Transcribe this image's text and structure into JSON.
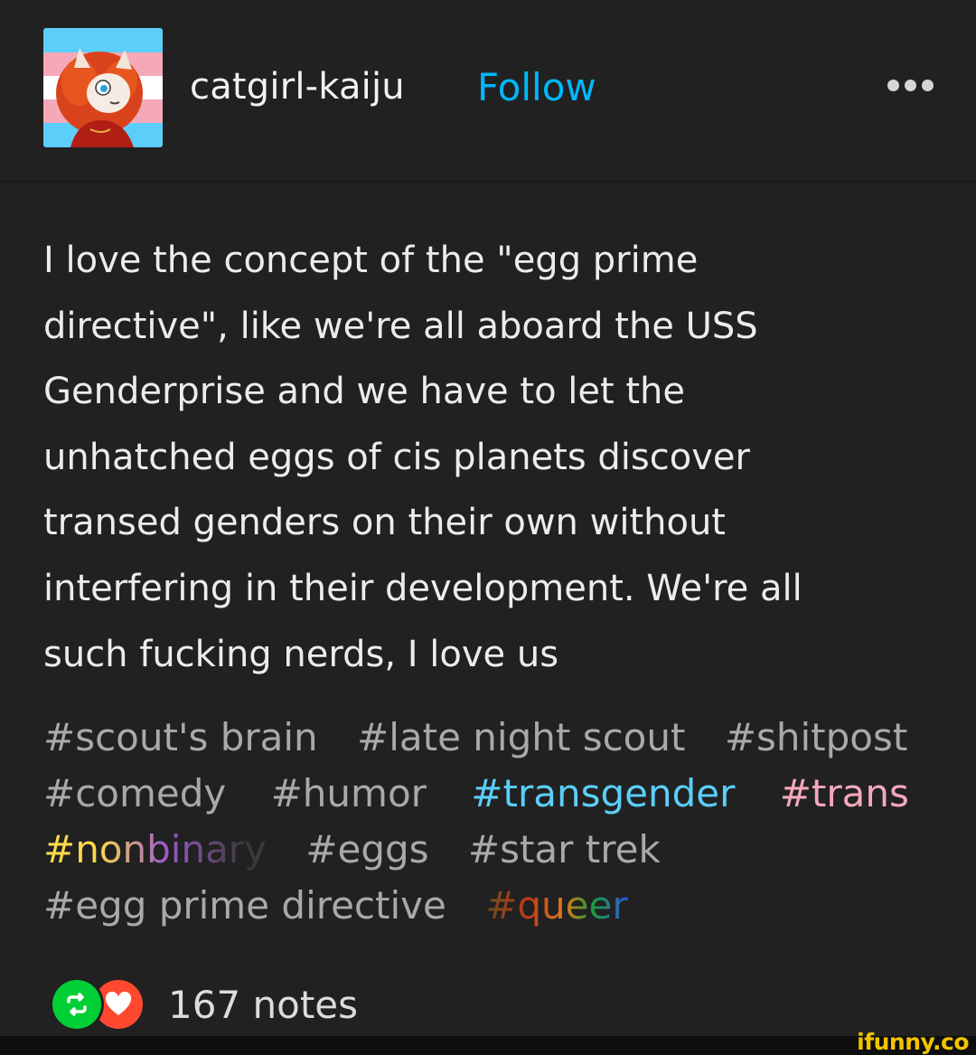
{
  "header": {
    "username": "catgirl-kaiju",
    "follow_label": "Follow",
    "more_icon": "more-horizontal-icon"
  },
  "post": {
    "lines": [
      "I love the concept of the \"egg prime",
      "directive\", like we're all aboard the USS",
      "Genderprise and we have to let the",
      "unhatched eggs of cis planets discover",
      "transed genders on their own without",
      "interfering in their development. We're all",
      "such fucking nerds, I love us"
    ]
  },
  "tags": [
    "#scout's brain",
    "#late night scout",
    "#shitpost",
    "#comedy",
    "#humor",
    "#transgender",
    "#trans",
    "#nonbinary",
    "#eggs",
    "#star trek",
    "#egg prime directive",
    "#queer"
  ],
  "footer": {
    "notes_label": "167 notes",
    "reblog_icon": "reblog-icon",
    "like_icon": "heart-icon"
  },
  "watermark": "ifunny.co",
  "colors": {
    "background": "#212121",
    "follow": "#00b8ff",
    "reblog": "#00cf35",
    "like": "#ff492f",
    "tag_trans_blue": "#5bcff9",
    "tag_trans_pink": "#f4a8bb"
  }
}
